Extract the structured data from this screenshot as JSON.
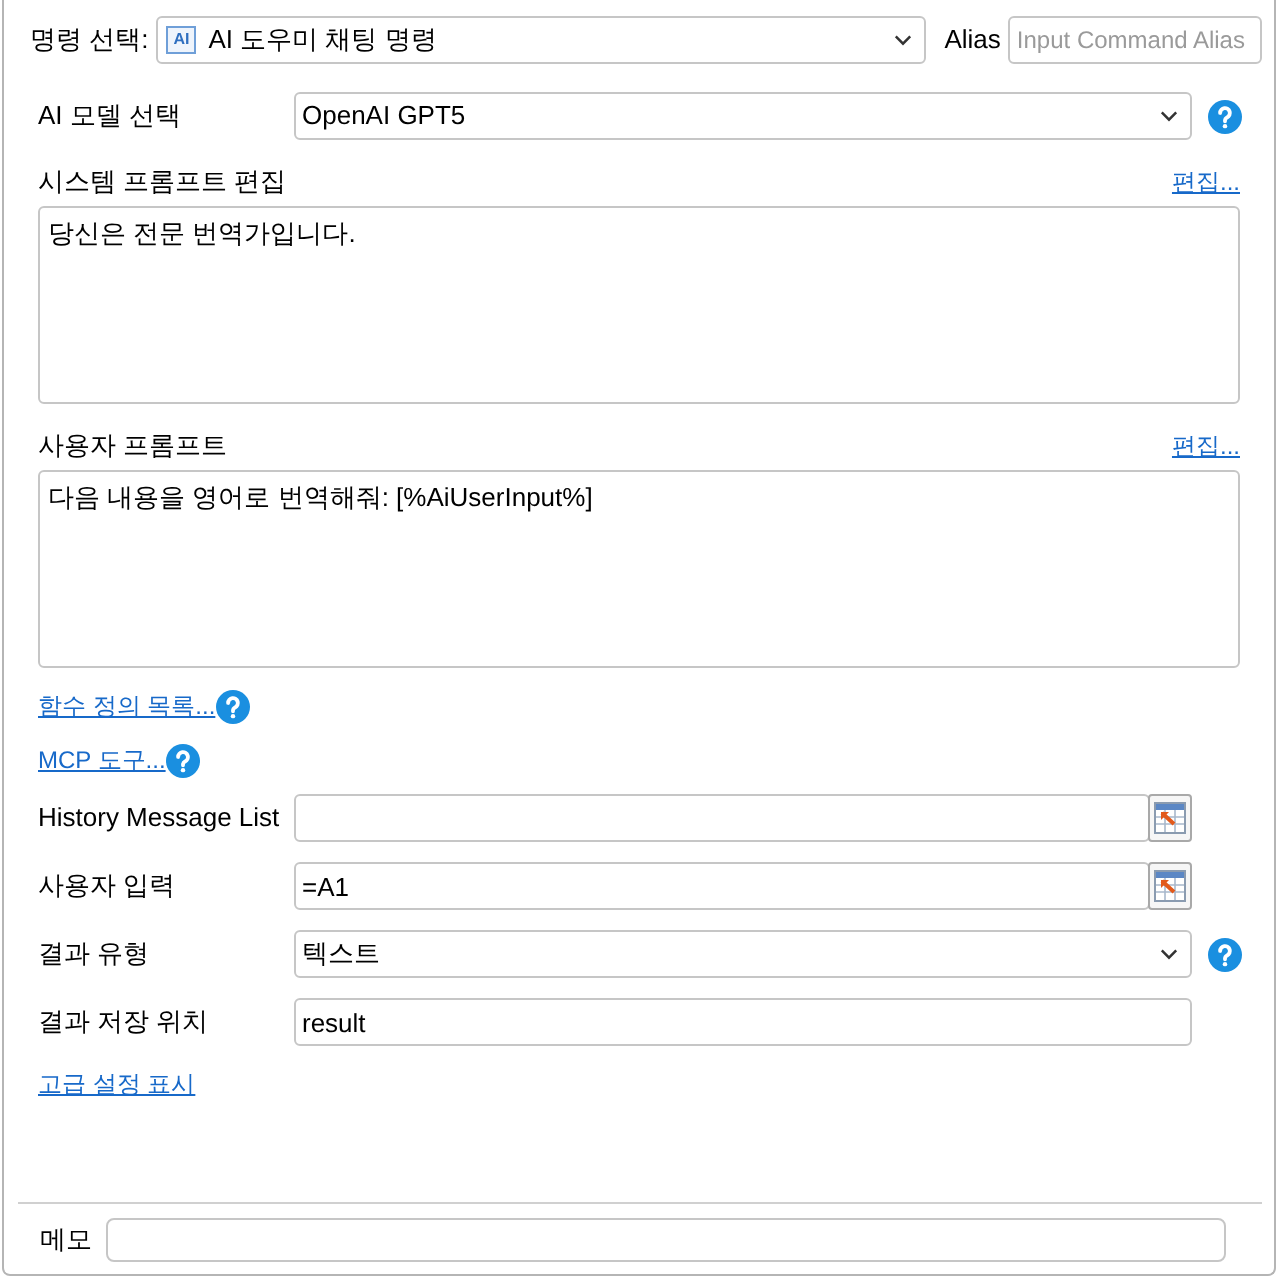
{
  "command": {
    "label": "명령 선택:",
    "icon_text": "AI",
    "value": "AI 도우미 채팅 명령"
  },
  "alias": {
    "label": "Alias",
    "placeholder": "Input Command Alias"
  },
  "model": {
    "label": "AI 모델 선택",
    "value": "OpenAI GPT5",
    "help": true
  },
  "system_prompt": {
    "label": "시스템 프롬프트 편집",
    "edit_link": "편집...",
    "value": "당신은 전문 번역가입니다."
  },
  "user_prompt": {
    "label": "사용자 프롬프트",
    "edit_link": "편집...",
    "value": "다음 내용을 영어로 번역해줘: [%AiUserInput%]"
  },
  "links": [
    {
      "text": "함수 정의 목록...",
      "help": true
    },
    {
      "text": "MCP 도구...",
      "help": true
    }
  ],
  "fields": [
    {
      "kind": "ref_input",
      "label": "History Message List"
    },
    {
      "kind": "ref_input",
      "label": "사용자 입력",
      "value": "=A1"
    },
    {
      "kind": "select",
      "label": "결과 유형",
      "value": "텍스트",
      "help": true
    },
    {
      "kind": "input",
      "label": "결과 저장 위치",
      "value": "result"
    }
  ],
  "advanced_link": "고급 설정 표시",
  "memo": {
    "label": "메모"
  }
}
